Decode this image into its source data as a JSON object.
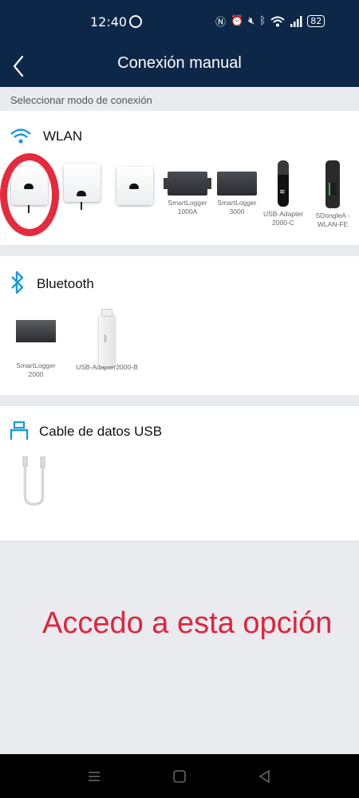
{
  "status_bar": {
    "time": "12:40",
    "battery": "82",
    "icons": [
      "whatsapp-icon",
      "nfc-icon",
      "alarm-icon",
      "mute-icon",
      "bluetooth-icon",
      "wifi-icon",
      "signal-icon",
      "battery-icon"
    ]
  },
  "header": {
    "title": "Conexión manual",
    "back_icon": "back-arrow-icon"
  },
  "subtitle": "Seleccionar modo de conexión",
  "sections": {
    "wlan": {
      "title": "WLAN",
      "icon": "wifi-icon",
      "devices": [
        {
          "label": ""
        },
        {
          "label": ""
        },
        {
          "label": ""
        },
        {
          "label": "SmartLogger 1000A"
        },
        {
          "label": "SmartLogger 3000"
        },
        {
          "label": "USB-Adapter 2000-C"
        },
        {
          "label": "SDongleA -WLAN-FE"
        }
      ]
    },
    "bluetooth": {
      "title": "Bluetooth",
      "icon": "bluetooth-icon",
      "devices": [
        {
          "label": "SmartLogger 2000"
        },
        {
          "label": "USB-Adapter2000-B"
        }
      ]
    },
    "usb": {
      "title": "Cable de datos USB",
      "icon": "usb-icon"
    }
  },
  "annotation": {
    "text": "Accedo a esta opción",
    "color": "#e2233d"
  },
  "colors": {
    "header_bg": "#0d2749",
    "accent_blue": "#1a9ae0",
    "highlight_red": "#e52a3d"
  },
  "nav_bar": {
    "buttons": [
      "menu-icon",
      "home-icon",
      "back-icon"
    ]
  }
}
